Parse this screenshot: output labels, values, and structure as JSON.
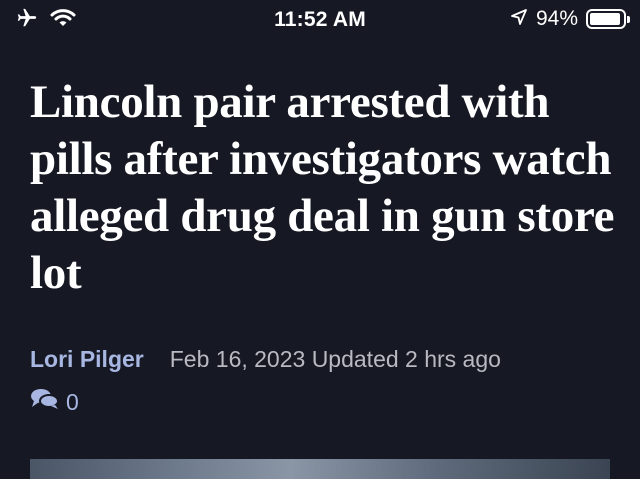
{
  "status_bar": {
    "time": "11:52 AM",
    "battery_percent": "94%",
    "battery_level": 0.94,
    "icons": [
      "airplane-icon",
      "wifi-icon",
      "location-arrow-icon",
      "battery-icon"
    ]
  },
  "article": {
    "headline": "Lincoln pair arrested with pills after investigators watch alleged drug deal in gun store lot",
    "author": "Lori Pilger",
    "dates": "Feb 16, 2023 Updated 2 hrs ago",
    "comment_count": "0"
  },
  "colors": {
    "background": "#161823",
    "author_link": "#a7b7e2",
    "meta_text": "#b9bac1"
  }
}
